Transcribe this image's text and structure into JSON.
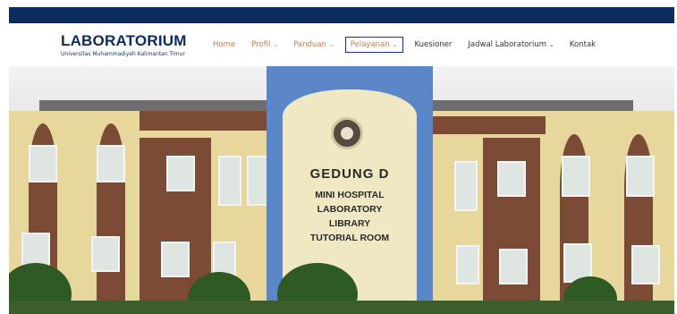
{
  "brand": {
    "title": "LABORATORIUM",
    "subtitle": "Universitas Muhammadiyah Kalimantan Timur"
  },
  "nav": {
    "items": [
      {
        "label": "Home",
        "dropdown": false,
        "color": "#e8742c"
      },
      {
        "label": "Profil",
        "dropdown": true,
        "color": "#e8742c"
      },
      {
        "label": "Panduan",
        "dropdown": true,
        "color": "#e8742c"
      },
      {
        "label": "Pelayanan",
        "dropdown": true,
        "color": "#e8742c",
        "highlighted": true
      },
      {
        "label": "Kuesioner",
        "dropdown": false,
        "color": "#333333"
      },
      {
        "label": "Jadwal Laboratorium",
        "dropdown": true,
        "color": "#333333"
      },
      {
        "label": "Kontak",
        "dropdown": false,
        "color": "#333333"
      }
    ],
    "chevron_icon": "chevron-down-icon"
  },
  "hero": {
    "sign_lines": [
      "GEDUNG D",
      "MINI HOSPITAL",
      "LABORATORY",
      "LIBRARY",
      "TUTORIAL ROOM"
    ]
  },
  "colors": {
    "topbar": "#0b2c5e",
    "brand": "#0b2c5e",
    "accent": "#e8742c",
    "highlight_border": "#1a2aa8"
  }
}
